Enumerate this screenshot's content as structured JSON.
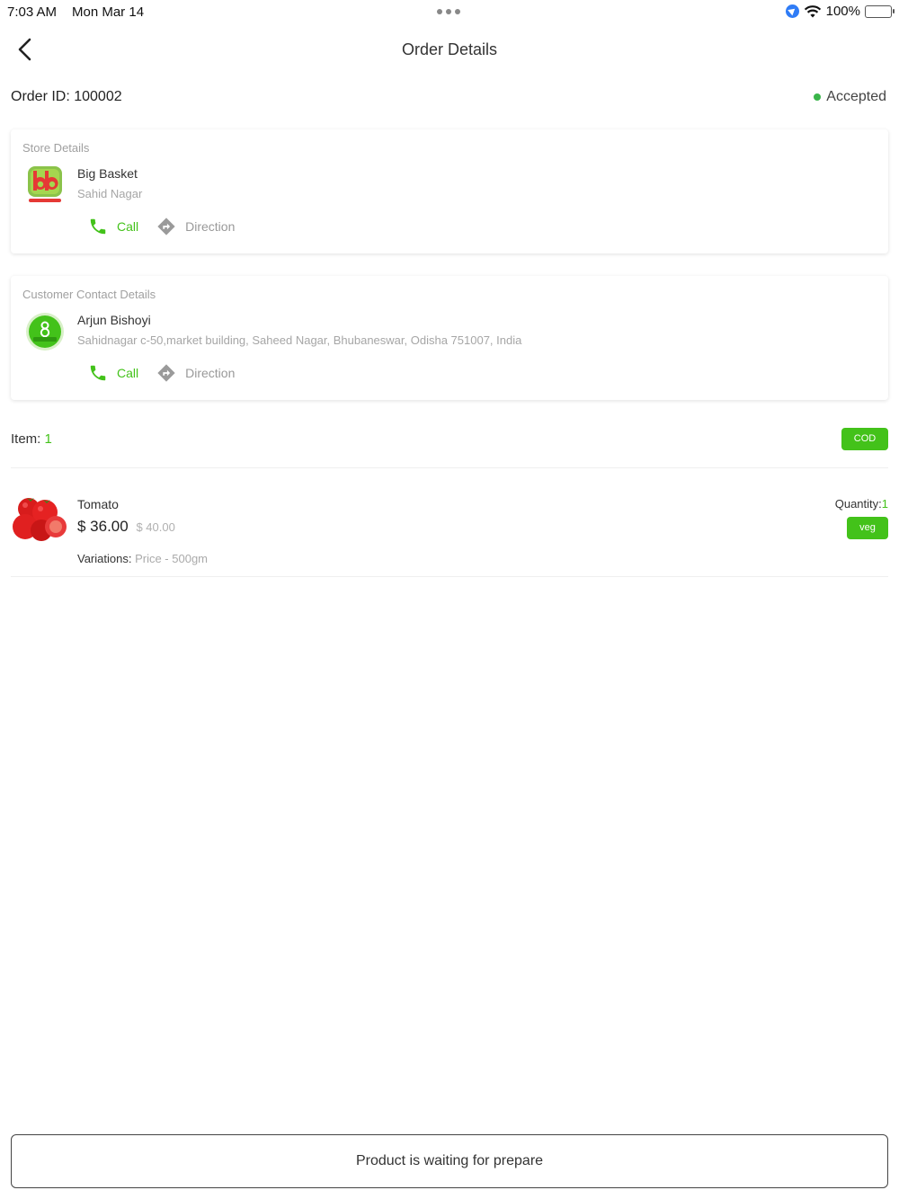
{
  "status_bar": {
    "time": "7:03 AM",
    "date": "Mon Mar 14",
    "battery": "100%"
  },
  "header": {
    "title": "Order Details"
  },
  "order": {
    "id_label": "Order ID: 100002",
    "status": "Accepted"
  },
  "store": {
    "section_label": "Store Details",
    "name": "Big Basket",
    "address": "Sahid Nagar",
    "call_label": "Call",
    "direction_label": "Direction"
  },
  "customer": {
    "section_label": "Customer Contact Details",
    "name": "Arjun Bishoyi",
    "address": "Sahidnagar c-50,market building, Saheed Nagar, Bhubaneswar, Odisha 751007, India",
    "call_label": "Call",
    "direction_label": "Direction"
  },
  "items": {
    "label": "Item: ",
    "count": "1",
    "payment_badge": "COD"
  },
  "product": {
    "name": "Tomato",
    "price": "$ 36.00",
    "old_price": "$ 40.00",
    "variations_label": "Variations: ",
    "variations_value": "Price - 500gm",
    "quantity_label": "Quantity:",
    "quantity_value": "1",
    "tag": "veg"
  },
  "footer": {
    "button_label": "Product is waiting for prepare"
  },
  "colors": {
    "accent": "#43c21a",
    "status_dot": "#3ab54a",
    "muted": "#a0a0a0"
  },
  "icons": [
    "back-chevron-icon",
    "location-icon",
    "wifi-icon",
    "battery-icon",
    "phone-icon",
    "direction-icon"
  ]
}
